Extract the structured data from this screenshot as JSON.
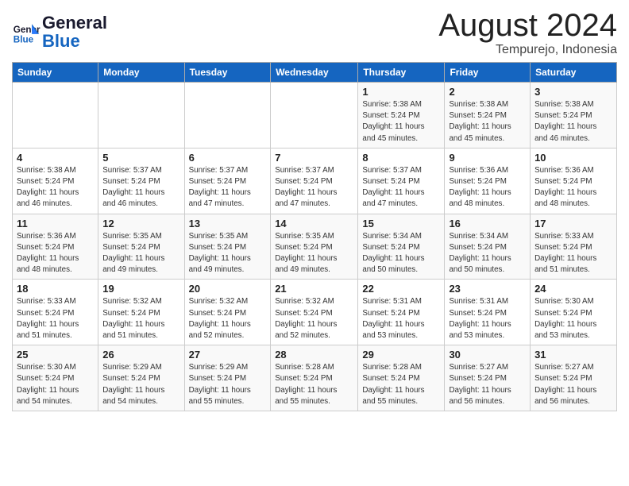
{
  "header": {
    "logo_general": "General",
    "logo_blue": "Blue",
    "month_year": "August 2024",
    "location": "Tempurejo, Indonesia"
  },
  "days_of_week": [
    "Sunday",
    "Monday",
    "Tuesday",
    "Wednesday",
    "Thursday",
    "Friday",
    "Saturday"
  ],
  "weeks": [
    [
      {
        "num": "",
        "info": ""
      },
      {
        "num": "",
        "info": ""
      },
      {
        "num": "",
        "info": ""
      },
      {
        "num": "",
        "info": ""
      },
      {
        "num": "1",
        "info": "Sunrise: 5:38 AM\nSunset: 5:24 PM\nDaylight: 11 hours\nand 45 minutes."
      },
      {
        "num": "2",
        "info": "Sunrise: 5:38 AM\nSunset: 5:24 PM\nDaylight: 11 hours\nand 45 minutes."
      },
      {
        "num": "3",
        "info": "Sunrise: 5:38 AM\nSunset: 5:24 PM\nDaylight: 11 hours\nand 46 minutes."
      }
    ],
    [
      {
        "num": "4",
        "info": "Sunrise: 5:38 AM\nSunset: 5:24 PM\nDaylight: 11 hours\nand 46 minutes."
      },
      {
        "num": "5",
        "info": "Sunrise: 5:37 AM\nSunset: 5:24 PM\nDaylight: 11 hours\nand 46 minutes."
      },
      {
        "num": "6",
        "info": "Sunrise: 5:37 AM\nSunset: 5:24 PM\nDaylight: 11 hours\nand 47 minutes."
      },
      {
        "num": "7",
        "info": "Sunrise: 5:37 AM\nSunset: 5:24 PM\nDaylight: 11 hours\nand 47 minutes."
      },
      {
        "num": "8",
        "info": "Sunrise: 5:37 AM\nSunset: 5:24 PM\nDaylight: 11 hours\nand 47 minutes."
      },
      {
        "num": "9",
        "info": "Sunrise: 5:36 AM\nSunset: 5:24 PM\nDaylight: 11 hours\nand 48 minutes."
      },
      {
        "num": "10",
        "info": "Sunrise: 5:36 AM\nSunset: 5:24 PM\nDaylight: 11 hours\nand 48 minutes."
      }
    ],
    [
      {
        "num": "11",
        "info": "Sunrise: 5:36 AM\nSunset: 5:24 PM\nDaylight: 11 hours\nand 48 minutes."
      },
      {
        "num": "12",
        "info": "Sunrise: 5:35 AM\nSunset: 5:24 PM\nDaylight: 11 hours\nand 49 minutes."
      },
      {
        "num": "13",
        "info": "Sunrise: 5:35 AM\nSunset: 5:24 PM\nDaylight: 11 hours\nand 49 minutes."
      },
      {
        "num": "14",
        "info": "Sunrise: 5:35 AM\nSunset: 5:24 PM\nDaylight: 11 hours\nand 49 minutes."
      },
      {
        "num": "15",
        "info": "Sunrise: 5:34 AM\nSunset: 5:24 PM\nDaylight: 11 hours\nand 50 minutes."
      },
      {
        "num": "16",
        "info": "Sunrise: 5:34 AM\nSunset: 5:24 PM\nDaylight: 11 hours\nand 50 minutes."
      },
      {
        "num": "17",
        "info": "Sunrise: 5:33 AM\nSunset: 5:24 PM\nDaylight: 11 hours\nand 51 minutes."
      }
    ],
    [
      {
        "num": "18",
        "info": "Sunrise: 5:33 AM\nSunset: 5:24 PM\nDaylight: 11 hours\nand 51 minutes."
      },
      {
        "num": "19",
        "info": "Sunrise: 5:32 AM\nSunset: 5:24 PM\nDaylight: 11 hours\nand 51 minutes."
      },
      {
        "num": "20",
        "info": "Sunrise: 5:32 AM\nSunset: 5:24 PM\nDaylight: 11 hours\nand 52 minutes."
      },
      {
        "num": "21",
        "info": "Sunrise: 5:32 AM\nSunset: 5:24 PM\nDaylight: 11 hours\nand 52 minutes."
      },
      {
        "num": "22",
        "info": "Sunrise: 5:31 AM\nSunset: 5:24 PM\nDaylight: 11 hours\nand 53 minutes."
      },
      {
        "num": "23",
        "info": "Sunrise: 5:31 AM\nSunset: 5:24 PM\nDaylight: 11 hours\nand 53 minutes."
      },
      {
        "num": "24",
        "info": "Sunrise: 5:30 AM\nSunset: 5:24 PM\nDaylight: 11 hours\nand 53 minutes."
      }
    ],
    [
      {
        "num": "25",
        "info": "Sunrise: 5:30 AM\nSunset: 5:24 PM\nDaylight: 11 hours\nand 54 minutes."
      },
      {
        "num": "26",
        "info": "Sunrise: 5:29 AM\nSunset: 5:24 PM\nDaylight: 11 hours\nand 54 minutes."
      },
      {
        "num": "27",
        "info": "Sunrise: 5:29 AM\nSunset: 5:24 PM\nDaylight: 11 hours\nand 55 minutes."
      },
      {
        "num": "28",
        "info": "Sunrise: 5:28 AM\nSunset: 5:24 PM\nDaylight: 11 hours\nand 55 minutes."
      },
      {
        "num": "29",
        "info": "Sunrise: 5:28 AM\nSunset: 5:24 PM\nDaylight: 11 hours\nand 55 minutes."
      },
      {
        "num": "30",
        "info": "Sunrise: 5:27 AM\nSunset: 5:24 PM\nDaylight: 11 hours\nand 56 minutes."
      },
      {
        "num": "31",
        "info": "Sunrise: 5:27 AM\nSunset: 5:24 PM\nDaylight: 11 hours\nand 56 minutes."
      }
    ]
  ]
}
